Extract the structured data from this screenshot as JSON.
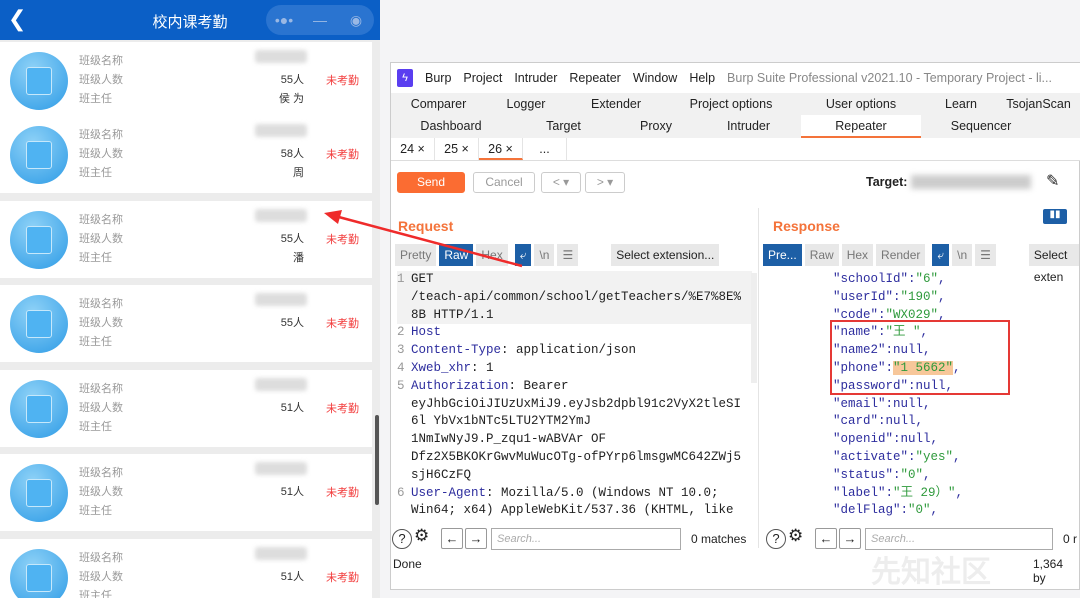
{
  "app": {
    "title": "校内课考勤",
    "back_icon": "chevron-left-icon",
    "more_icon": "more-dots-icon",
    "minimize_icon": "minus-icon",
    "close_icon": "target-circle-icon",
    "header_color": "#0b5fc6"
  },
  "card_labels": {
    "name": "班级名称",
    "count": "班级人数",
    "teacher": "班主任"
  },
  "cards": [
    {
      "count": "55人",
      "teacher": "侯 为",
      "status": "未考勤"
    },
    {
      "count": "58人",
      "teacher": "周",
      "status": "未考勤"
    },
    {
      "count": "55人",
      "teacher": "潘",
      "status": "未考勤"
    },
    {
      "count": "55人",
      "teacher": "",
      "status": "未考勤"
    },
    {
      "count": "51人",
      "teacher": "",
      "status": "未考勤"
    },
    {
      "count": "51人",
      "teacher": "",
      "status": "未考勤"
    },
    {
      "count": "51人",
      "teacher": "",
      "status": "未考勤"
    }
  ],
  "burp": {
    "menu": [
      "Burp",
      "Project",
      "Intruder",
      "Repeater",
      "Window",
      "Help"
    ],
    "window_title": "Burp Suite Professional v2021.10 - Temporary Project - li...",
    "tabs_row1": [
      "Comparer",
      "Logger",
      "Extender",
      "Project options",
      "User options",
      "Learn",
      "TsojanScan"
    ],
    "tabs_row2": [
      "Dashboard",
      "Target",
      "Proxy",
      "Intruder",
      "Repeater",
      "Sequencer"
    ],
    "active_tab": "Repeater",
    "repeater_tabs": [
      "24 ×",
      "25 ×",
      "26 ×",
      "..."
    ],
    "active_repeater_tab": "26 ×",
    "send": "Send",
    "cancel": "Cancel",
    "prev": "<",
    "next": ">",
    "target_label": "Target:",
    "request": {
      "title": "Request",
      "tabs": [
        "Pretty",
        "Raw",
        "Hex"
      ],
      "active": "Raw",
      "newline": "\\n",
      "select_ext": "Select extension...",
      "lines": [
        {
          "n": "1",
          "key": "",
          "text": "GET"
        },
        {
          "n": "",
          "key": "",
          "text": "/teach-api/common/school/getTeachers/%E7%8E%"
        },
        {
          "n": "",
          "key": "",
          "text": "8B HTTP/1.1"
        },
        {
          "n": "2",
          "key": "Host",
          "text": ""
        },
        {
          "n": "3",
          "key": "Content-Type",
          "text": ": application/json"
        },
        {
          "n": "4",
          "key": "Xweb_xhr",
          "text": ": 1"
        },
        {
          "n": "5",
          "key": "Authorization",
          "text": ": Bearer"
        },
        {
          "n": "",
          "key": "",
          "text": "eyJhbGciOiJIUzUxMiJ9.eyJsb2dpbl91c2VyX2tleSI"
        },
        {
          "n": "",
          "key": "",
          "text": "6l                  YbVx1bNTc5LTU2YTM2YmJ"
        },
        {
          "n": "",
          "key": "",
          "text": "1NmIwNyJ9.P_zqu1-wABVAr                   OF"
        },
        {
          "n": "",
          "key": "",
          "text": "Dfz2X5BKOKrGwvMuWucOTg-ofPYrp6lmsgwMC642ZWj5"
        },
        {
          "n": "",
          "key": "",
          "text": "sjH6CzFQ"
        },
        {
          "n": "6",
          "key": "User-Agent",
          "text": ": Mozilla/5.0 (Windows NT 10.0;"
        },
        {
          "n": "",
          "key": "",
          "text": "Win64; x64) AppleWebKit/537.36 (KHTML, like"
        }
      ],
      "search_placeholder": "Search...",
      "matches": "0 matches"
    },
    "response": {
      "title": "Response",
      "tabs": [
        "Pre...",
        "Raw",
        "Hex",
        "Render"
      ],
      "active": "Pre...",
      "newline": "\\n",
      "select_ext": "Select exten",
      "lines": [
        {
          "k": "\"schoolId\"",
          "v": "\"6\"",
          "c": ","
        },
        {
          "k": "\"userId\"",
          "v": "\"190\"",
          "c": ","
        },
        {
          "k": "\"code\"",
          "v": "\"WX029\"",
          "c": ","
        },
        {
          "k": "\"name\"",
          "v": "\"王  \"",
          "c": ","
        },
        {
          "k": "\"name2\"",
          "v": "null",
          "c": ","
        },
        {
          "k": "\"phone\"",
          "v": "\"1      5662\"",
          "c": ","
        },
        {
          "k": "\"password\"",
          "v": "null",
          "c": ","
        },
        {
          "k": "\"email\"",
          "v": "null",
          "c": ","
        },
        {
          "k": "\"card\"",
          "v": "null",
          "c": ","
        },
        {
          "k": "\"openid\"",
          "v": "null",
          "c": ","
        },
        {
          "k": "\"activate\"",
          "v": "\"yes\"",
          "c": ","
        },
        {
          "k": "\"status\"",
          "v": "\"0\"",
          "c": ","
        },
        {
          "k": "\"label\"",
          "v": "\"王       29）\"",
          "c": ","
        },
        {
          "k": "\"delFlag\"",
          "v": "\"0\"",
          "c": ","
        }
      ],
      "search_placeholder": "Search...",
      "matches": "0 r",
      "size": "1,364 by"
    },
    "status": "Done",
    "accent": "#fb6c32",
    "highlight_box_color": "#e53935"
  },
  "watermark": "先知社区"
}
